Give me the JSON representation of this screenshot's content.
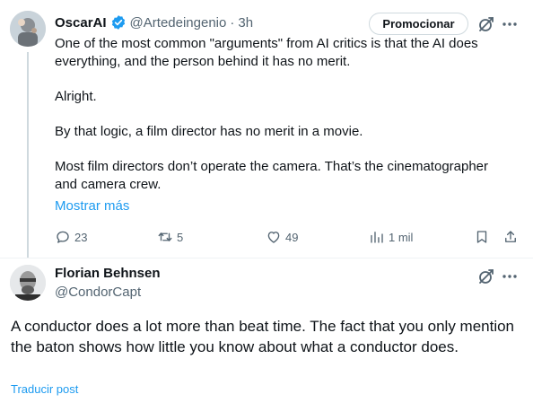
{
  "tweet": {
    "author_name": "OscarAI",
    "handle": "@Artedeingenio",
    "separator": "·",
    "time": "3h",
    "promote_label": "Promocionar",
    "paragraphs": [
      "One of the most common \"arguments\" from AI critics is that the AI does everything, and the person behind it has no merit.",
      "Alright.",
      "By that logic, a film director has no merit in a movie.",
      "Most film directors don’t operate the camera. That’s the cinematographer and camera crew."
    ],
    "show_more": "Mostrar más",
    "actions": {
      "replies": "23",
      "reposts": "5",
      "likes": "49",
      "views": "1 mil"
    }
  },
  "reply": {
    "author_name": "Florian Behnsen",
    "handle": "@CondorCapt",
    "text": "A conductor does a lot more than beat time. The fact that you only mention the baton shows how little you know about what a conductor does.",
    "translate": "Traducir post"
  },
  "colors": {
    "accent": "#1d9bf0",
    "verified": "#1d9bf0",
    "muted_text": "#536471",
    "text": "#0f1419"
  },
  "icons": [
    "verified-badge-icon",
    "grok-icon",
    "more-icon",
    "reply-icon",
    "repost-icon",
    "like-icon",
    "views-icon",
    "bookmark-icon",
    "share-icon"
  ]
}
